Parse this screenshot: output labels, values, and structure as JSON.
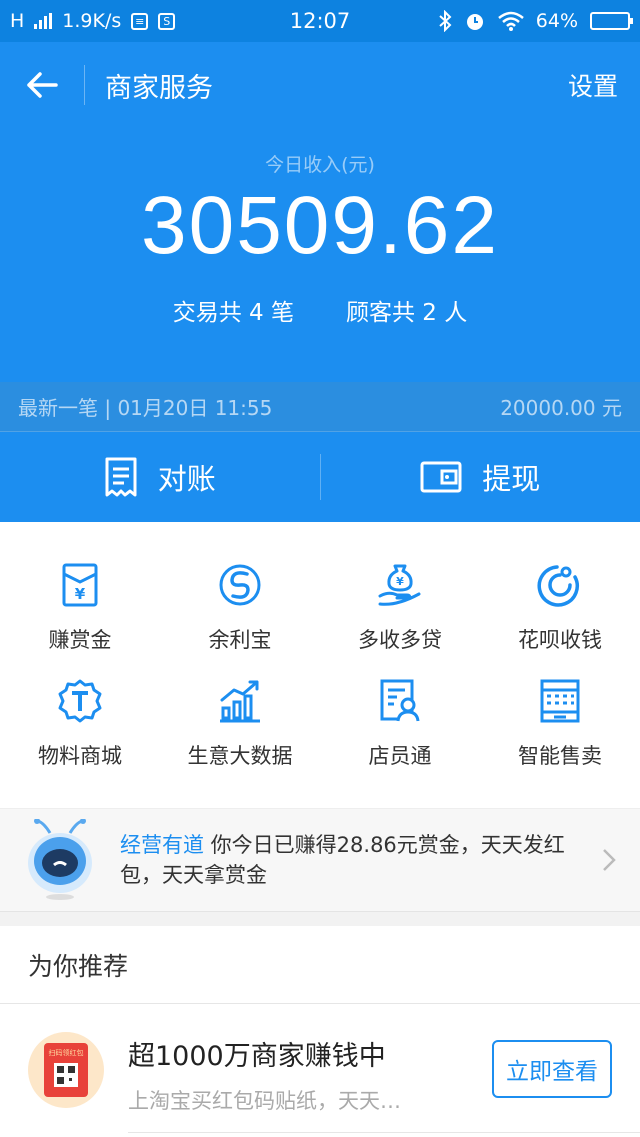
{
  "status_bar": {
    "network": "H",
    "speed": "1.9K/s",
    "time": "12:07",
    "battery": "64%",
    "icons": [
      "signal-icon",
      "notification-icon",
      "sim-icon",
      "bluetooth-icon",
      "alarm-icon",
      "wifi-icon",
      "battery-icon"
    ]
  },
  "header": {
    "title": "商家服务",
    "settings": "设置",
    "income_label": "今日收入(元)",
    "income": "30509.62",
    "transactions": "交易共 4 笔",
    "customers": "顾客共 2 人",
    "latest": "最新一笔 | 01月20日 11:55",
    "latest_amount": "20000.00 元"
  },
  "actions": {
    "reconcile": "对账",
    "withdraw": "提现"
  },
  "services": [
    {
      "label": "赚赏金",
      "icon": "red-envelope-icon"
    },
    {
      "label": "余利宝",
      "icon": "yulibao-icon"
    },
    {
      "label": "多收多贷",
      "icon": "money-bag-hand-icon"
    },
    {
      "label": "花呗收钱",
      "icon": "huabei-icon"
    },
    {
      "label": "物料商城",
      "icon": "t-badge-icon"
    },
    {
      "label": "生意大数据",
      "icon": "bar-chart-icon"
    },
    {
      "label": "店员通",
      "icon": "staff-icon"
    },
    {
      "label": "智能售卖",
      "icon": "vending-icon"
    }
  ],
  "banner": {
    "highlight": "经营有道",
    "text": " 你今日已赚得28.86元赏金，天天发红包，天天拿赏金"
  },
  "recommend": {
    "section_title": "为你推荐",
    "item_title": "超1000万商家赚钱中",
    "item_desc": "上淘宝买红包码贴纸，天天…",
    "item_button": "立即查看",
    "icon_text": "扫码领红包"
  },
  "colors": {
    "primary": "#1c8ef0",
    "status_bar": "#0d82e0"
  }
}
